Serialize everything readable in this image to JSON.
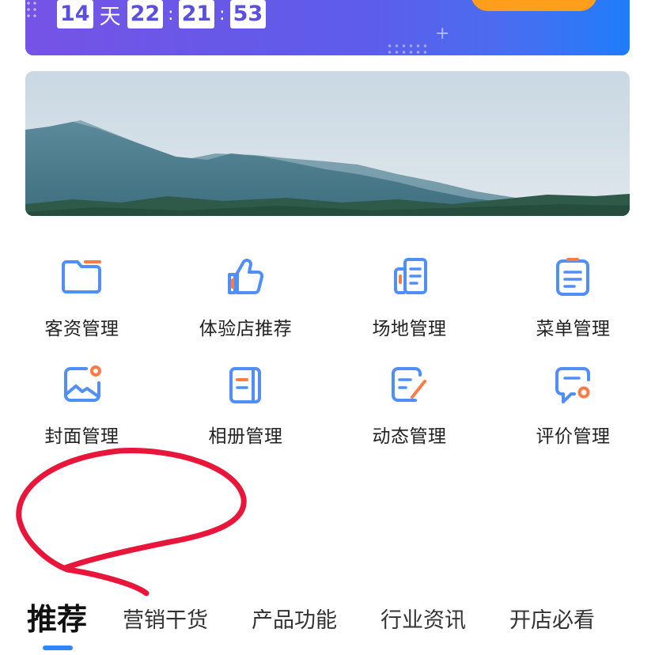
{
  "promo": {
    "countdown": {
      "days": "14",
      "day_unit": "天",
      "hours": "22",
      "minutes": "21",
      "seconds": "53",
      "separator": ":"
    }
  },
  "functions": [
    {
      "label": "客资管理",
      "icon": "folder-icon"
    },
    {
      "label": "体验店推荐",
      "icon": "thumbs-up-icon"
    },
    {
      "label": "场地管理",
      "icon": "venue-icon"
    },
    {
      "label": "菜单管理",
      "icon": "clipboard-icon"
    },
    {
      "label": "封面管理",
      "icon": "image-icon"
    },
    {
      "label": "相册管理",
      "icon": "album-icon"
    },
    {
      "label": "动态管理",
      "icon": "edit-icon"
    },
    {
      "label": "评价管理",
      "icon": "comment-icon"
    }
  ],
  "tabs": {
    "items": [
      {
        "label": "推荐"
      },
      {
        "label": "营销干货"
      },
      {
        "label": "产品功能"
      },
      {
        "label": "行业资讯"
      },
      {
        "label": "开店必看"
      }
    ],
    "active_index": 0
  },
  "colors": {
    "icon_blue": "#4f8ff7",
    "icon_accent": "#ff7a45",
    "tab_indicator": "#2f86f6",
    "annotation": "#e8163a"
  }
}
